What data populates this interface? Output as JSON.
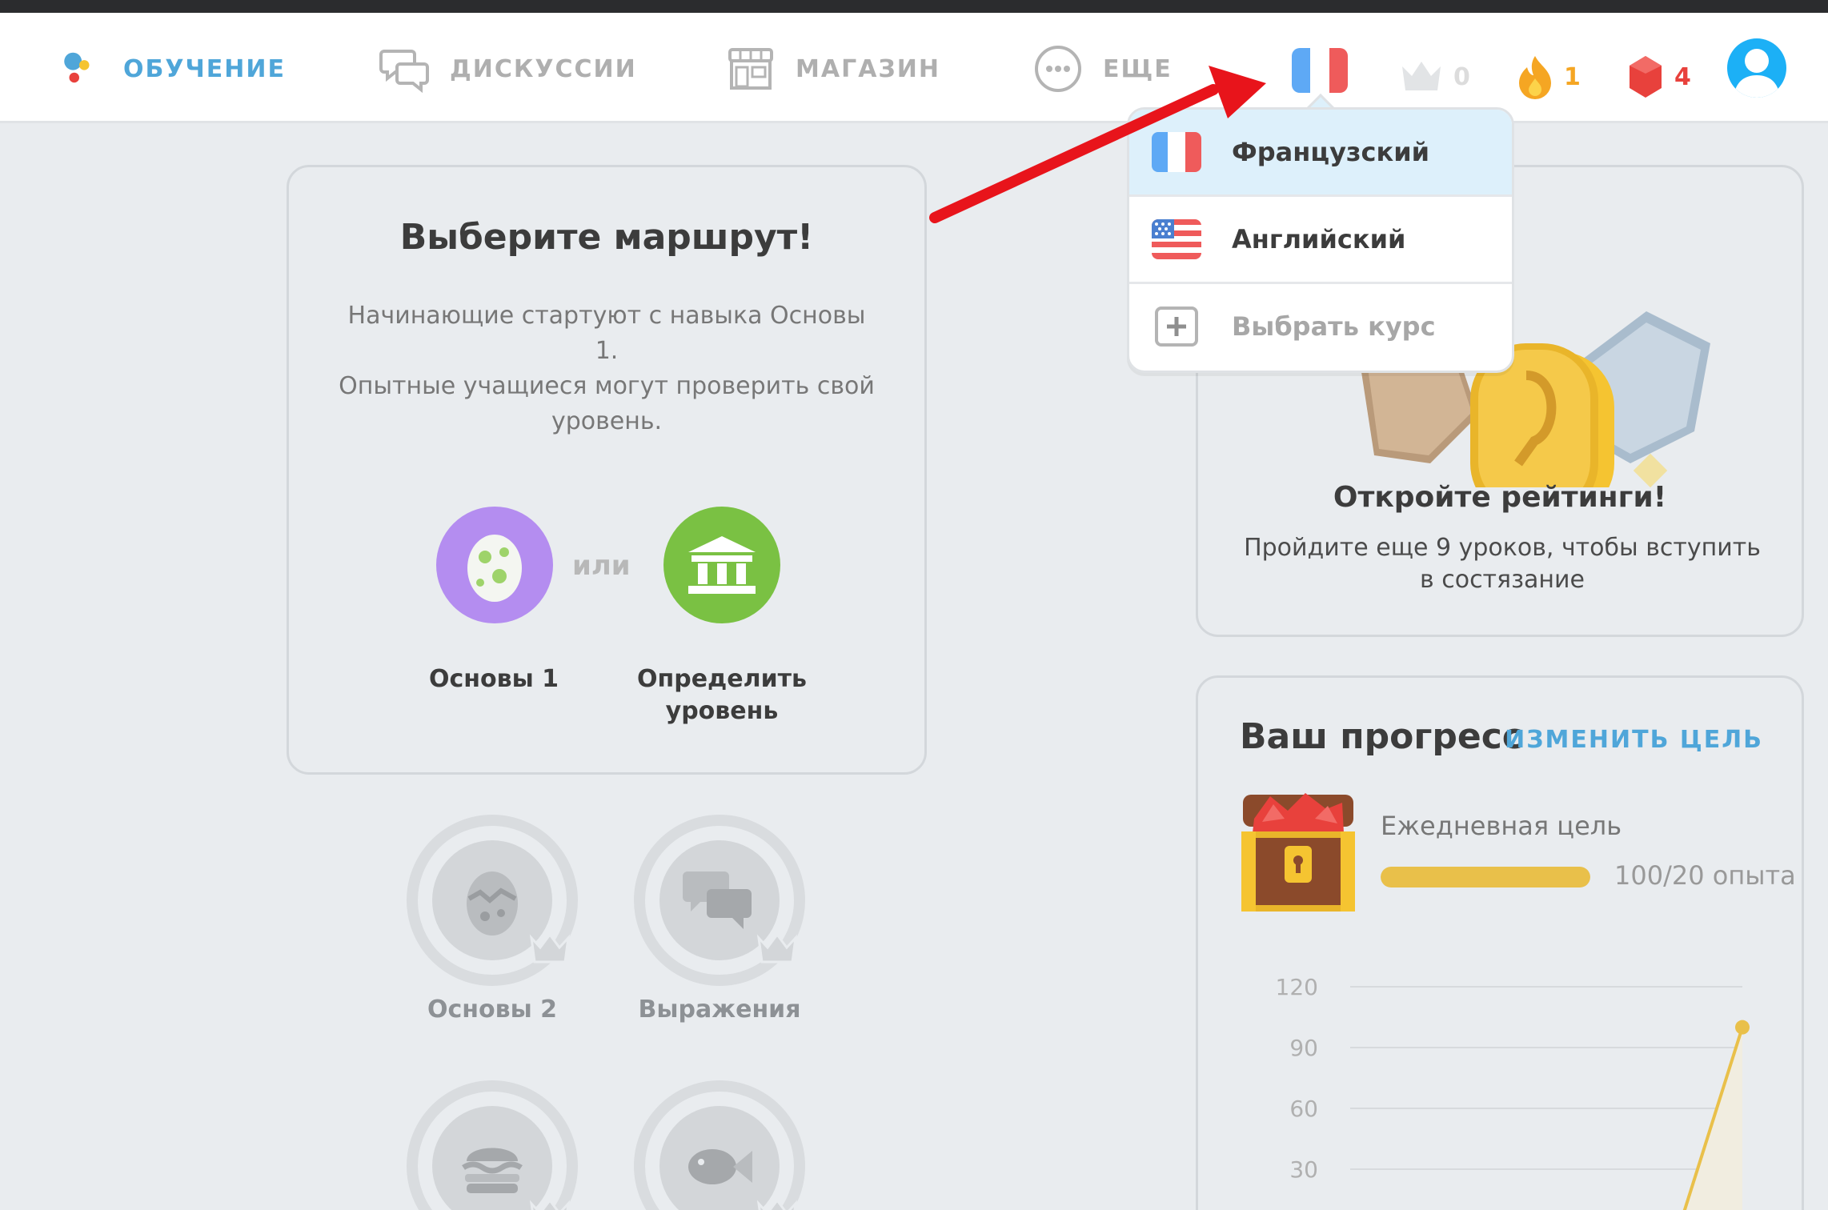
{
  "nav": {
    "items": [
      {
        "label": "ОБУЧЕНИЕ",
        "icon": "app-logo-icon",
        "active": true
      },
      {
        "label": "ДИСКУССИИ",
        "icon": "chat-bubbles-icon",
        "active": false
      },
      {
        "label": "МАГАЗИН",
        "icon": "shop-icon",
        "active": false
      },
      {
        "label": "ЕЩЕ",
        "icon": "more-dots-icon",
        "active": false
      }
    ],
    "crowns": "0",
    "streak": "1",
    "gems": "4"
  },
  "dropdown": {
    "items": [
      {
        "label": "Французский",
        "flag": "fr-flag-icon",
        "selected": true
      },
      {
        "label": "Английский",
        "flag": "us-flag-icon",
        "selected": false
      },
      {
        "label": "Выбрать курс",
        "flag": "plus-icon",
        "selected": false
      }
    ]
  },
  "route": {
    "title": "Выберите маршрут!",
    "desc_line1": "Начинающие стартуют с навыка Основы",
    "desc_line2": "1.",
    "desc_line3": "Опытные учащиеся могут проверить свой",
    "desc_line4": "уровень.",
    "or": "или",
    "basics_label": "Основы 1",
    "placement_line1": "Определить",
    "placement_line2": "уровень"
  },
  "locked_skills": [
    {
      "label": "Основы 2",
      "icon": "egg-icon"
    },
    {
      "label": "Выражения",
      "icon": "chat-bubbles-icon"
    },
    {
      "label": "",
      "icon": "burger-icon"
    },
    {
      "label": "",
      "icon": "fish-icon"
    }
  ],
  "league": {
    "title": "Откройте рейтинги!",
    "desc_line1": "Пройдите еще 9 уроков, чтобы вступить",
    "desc_line2": "в состязание"
  },
  "progress": {
    "title": "Ваш прогресс",
    "change_goal": "ИЗМЕНИТЬ ЦЕЛЬ",
    "goal_label": "Ежедневная цель",
    "goal_value": "100/20 опыта",
    "goal_fraction": 1.0
  },
  "chart_data": {
    "type": "line",
    "ylim": [
      0,
      120
    ],
    "yticks": [
      "120",
      "90",
      "60",
      "30"
    ],
    "series": [
      {
        "values": [
          0,
          100
        ]
      }
    ]
  },
  "colors": {
    "accent": "#4fa6d9",
    "streak": "#f5a623",
    "gems": "#e8413c",
    "basics": "#b48df0",
    "placement": "#7ac143",
    "goal": "#e9c04a"
  }
}
